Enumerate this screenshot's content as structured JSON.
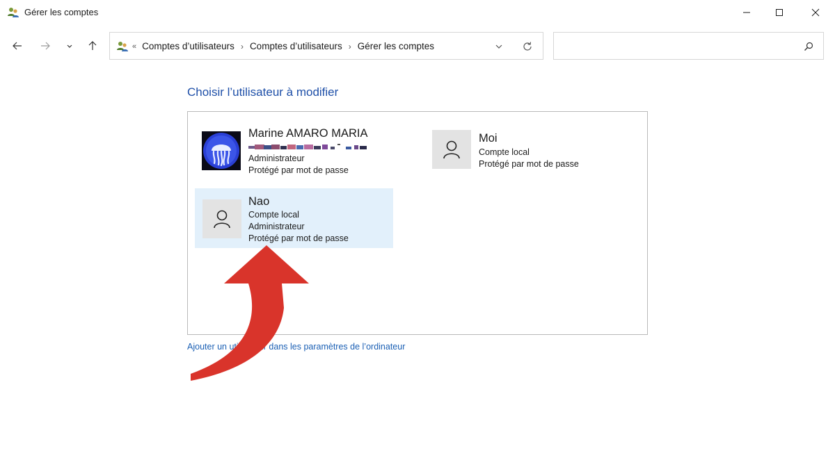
{
  "window": {
    "title": "Gérer les comptes"
  },
  "addressbar": {
    "overflow": "«",
    "crumbs": [
      "Comptes d’utilisateurs",
      "Comptes d’utilisateurs",
      "Gérer les comptes"
    ]
  },
  "search": {
    "value": "",
    "placeholder": ""
  },
  "content": {
    "heading": "Choisir l’utilisateur à modifier",
    "add_link": "Ajouter un utilisateur dans les paramètres de l’ordinateur"
  },
  "accounts": [
    {
      "name": "Marine AMARO MARIA",
      "lines": [
        "Administrateur",
        "Protégé par mot de passe"
      ],
      "avatar": "jellyfish-avatar",
      "selected": false
    },
    {
      "name": "Moi",
      "lines": [
        "Compte local",
        "Protégé par mot de passe"
      ],
      "avatar": "user-icon",
      "selected": false
    },
    {
      "name": "Nao",
      "lines": [
        "Compte local",
        "Administrateur",
        "Protégé par mot de passe"
      ],
      "avatar": "user-icon",
      "selected": true
    }
  ],
  "colors": {
    "accent_heading": "#1e4fa8",
    "link": "#1a5fb4",
    "selection": "#e2f0fb",
    "annotation_arrow": "#d9342b"
  }
}
